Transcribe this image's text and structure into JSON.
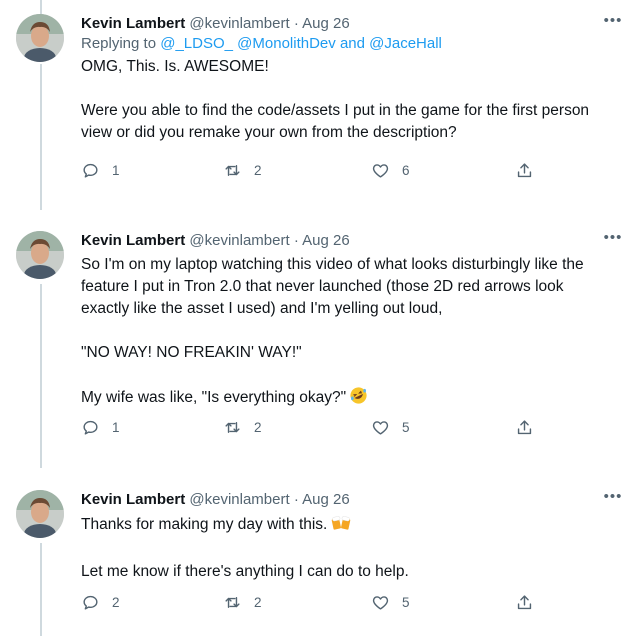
{
  "tweets": [
    {
      "author_name": "Kevin Lambert",
      "handle": "@kevinlambert",
      "separator": "·",
      "date": "Aug 26",
      "more_label": "•••",
      "replying_prefix": "Replying to",
      "replying_to": [
        "@_LDSO_",
        "@MonolithDev",
        "and",
        "@JaceHall"
      ],
      "lines": [
        "OMG, This. Is. AWESOME!",
        "",
        "Were you able to find the code/assets I put in the game for the first person",
        "view or did you remake your own from the description?"
      ],
      "reply_count": "1",
      "retweet_count": "2",
      "like_count": "6"
    },
    {
      "author_name": "Kevin Lambert",
      "handle": "@kevinlambert",
      "separator": "·",
      "date": "Aug 26",
      "more_label": "•••",
      "lines": [
        "So I'm on my laptop watching this video of what looks disturbingly like the",
        "feature I put in Tron 2.0 that never launched (those 2D red arrows look",
        "exactly like the asset I used) and I'm yelling out loud,",
        "",
        "\"NO WAY! NO FREAKIN' WAY!\"",
        "",
        "My wife was like, \"Is everything okay?\""
      ],
      "emoji": "rolling-on-floor-laughing",
      "reply_count": "1",
      "retweet_count": "2",
      "like_count": "5"
    },
    {
      "author_name": "Kevin Lambert",
      "handle": "@kevinlambert",
      "separator": "·",
      "date": "Aug 26",
      "more_label": "•••",
      "lines": [
        "Thanks for making my day with this.",
        "",
        "Let me know if there's anything I can do to help."
      ],
      "emoji": "clinking-beer-mugs",
      "reply_count": "2",
      "retweet_count": "2",
      "like_count": "5"
    }
  ],
  "icons": {
    "reply": "reply-icon",
    "retweet": "retweet-icon",
    "like": "heart-icon",
    "share": "share-icon",
    "more": "more-icon"
  },
  "colors": {
    "text": "#0f1419",
    "secondary": "#536471",
    "link": "#1d9bf0",
    "thread_line": "#cfd9de"
  }
}
